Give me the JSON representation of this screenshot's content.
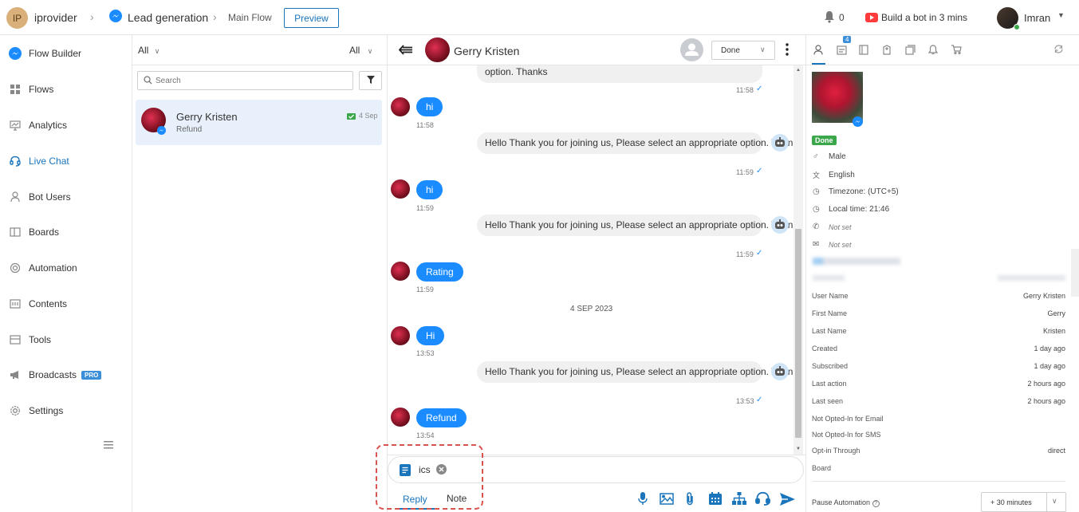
{
  "topbar": {
    "avatar_initials": "IP",
    "brand": "iprovider",
    "breadcrumb_bot": "Lead generation",
    "breadcrumb_flow": "Main Flow",
    "preview_label": "Preview",
    "notif_count": "0",
    "build_bot_label": "Build a bot in 3 mins",
    "user_name": "Imran"
  },
  "sidebar": {
    "items": [
      {
        "label": "Flow Builder",
        "icon": "messenger-icon"
      },
      {
        "label": "Flows",
        "icon": "grid-icon"
      },
      {
        "label": "Analytics",
        "icon": "analytics-icon"
      },
      {
        "label": "Live Chat",
        "icon": "headset-icon"
      },
      {
        "label": "Bot Users",
        "icon": "user-icon"
      },
      {
        "label": "Boards",
        "icon": "board-icon"
      },
      {
        "label": "Automation",
        "icon": "automation-icon"
      },
      {
        "label": "Contents",
        "icon": "contents-icon"
      },
      {
        "label": "Tools",
        "icon": "tools-icon"
      },
      {
        "label": "Broadcasts",
        "icon": "megaphone-icon",
        "badge": "PRO"
      },
      {
        "label": "Settings",
        "icon": "gear-icon"
      }
    ]
  },
  "conversations": {
    "filter_left": "All",
    "filter_right": "All",
    "search_placeholder": "Search",
    "items": [
      {
        "name": "Gerry Kristen",
        "preview": "Refund",
        "date": "4 Sep"
      }
    ]
  },
  "chat": {
    "contact_name": "Gerry Kristen",
    "status_select": "Done",
    "partial_msg": "option. Thanks",
    "partial_time": "11:58",
    "messages": [
      {
        "dir": "in",
        "text": "hi",
        "time": "11:58"
      },
      {
        "dir": "out",
        "text": "Hello Thank you for joining us, Please select an appropriate option. Thanks",
        "time": "11:59"
      },
      {
        "dir": "in",
        "text": "hi",
        "time": "11:59"
      },
      {
        "dir": "out",
        "text": "Hello Thank you for joining us, Please select an appropriate option. Thanks",
        "time": "11:59"
      },
      {
        "dir": "in",
        "text": "Rating",
        "time": "11:59"
      },
      {
        "dir": "in",
        "text": "Hi",
        "time": "13:53"
      },
      {
        "dir": "out",
        "text": "Hello Thank you for joining us, Please select an appropriate option. Thanks",
        "time": "13:53"
      },
      {
        "dir": "in",
        "text": "Refund",
        "time": "13:54"
      }
    ],
    "date_divider": "4 SEP 2023",
    "attachment_name": "ics",
    "tab_reply": "Reply",
    "tab_note": "Note"
  },
  "profile": {
    "tab_badge": "4",
    "status_badge": "Done",
    "gender": "Male",
    "language": "English",
    "timezone": "Timezone: (UTC+5)",
    "local_time": "Local time: 21:46",
    "phone": "Not set",
    "email": "Not set",
    "fields": [
      {
        "k": "User Name",
        "v": "Gerry Kristen"
      },
      {
        "k": "First Name",
        "v": "Gerry"
      },
      {
        "k": "Last Name",
        "v": "Kristen"
      },
      {
        "k": "Created",
        "v": "1 day ago"
      },
      {
        "k": "Subscribed",
        "v": "1 day ago"
      },
      {
        "k": "Last action",
        "v": "2 hours ago"
      },
      {
        "k": "Last seen",
        "v": "2 hours ago"
      },
      {
        "k": "Not Opted-In for Email",
        "v": ""
      },
      {
        "k": "Not Opted-In for SMS",
        "v": ""
      },
      {
        "k": "Opt-in Through",
        "v": "direct"
      },
      {
        "k": "Board",
        "v": ""
      }
    ],
    "pause_label": "Pause Automation",
    "pause_value": "+ 30 minutes"
  },
  "colors": {
    "accent": "#1b75bb",
    "bubble": "#1a8cff",
    "done": "#3aa84a",
    "highlight": "#d9534f"
  }
}
